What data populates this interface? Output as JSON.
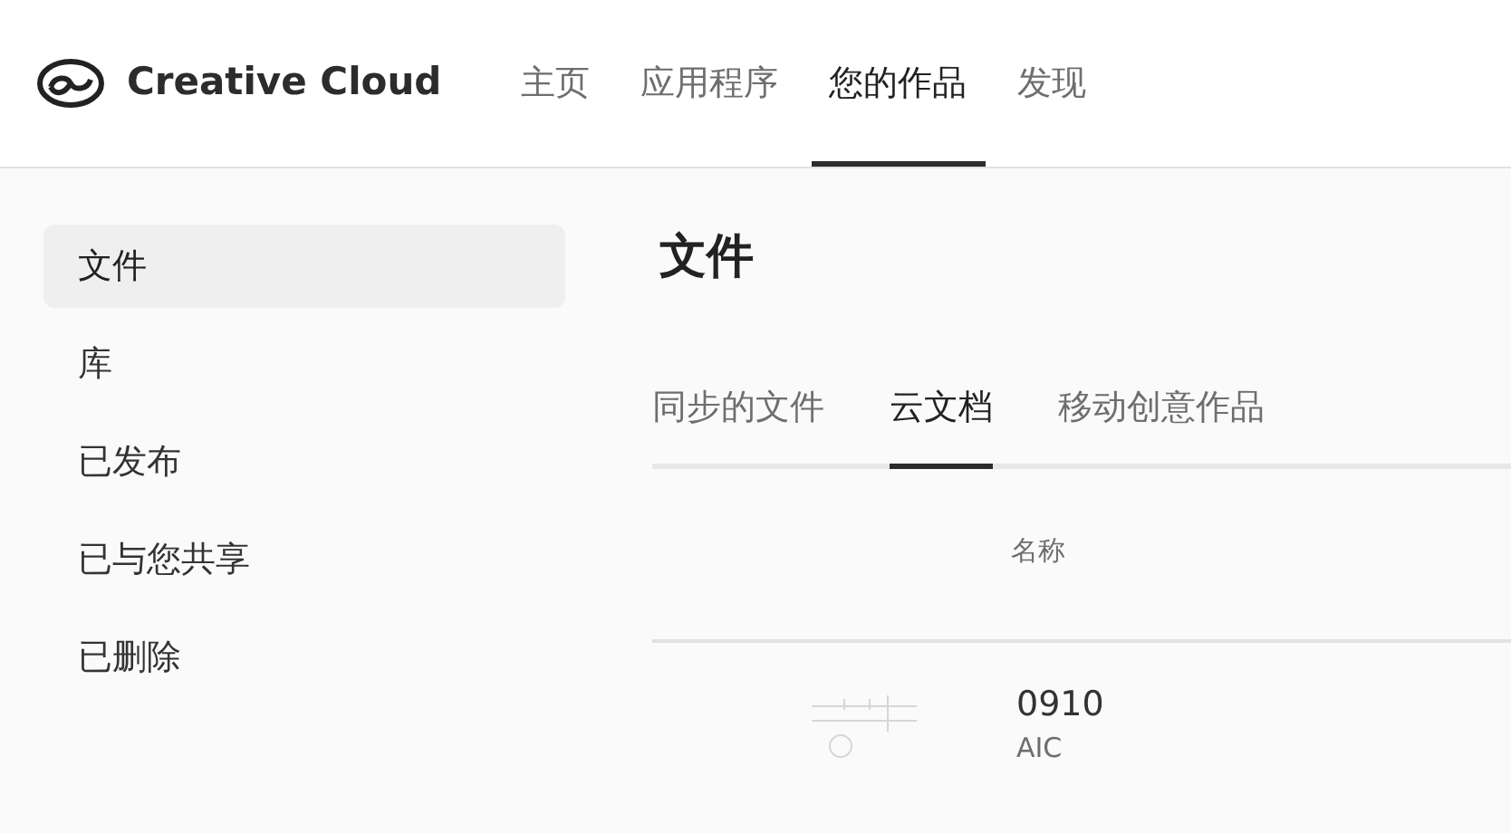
{
  "app": {
    "name": "Creative Cloud"
  },
  "nav": [
    {
      "label": "主页",
      "selected": false
    },
    {
      "label": "应用程序",
      "selected": false
    },
    {
      "label": "您的作品",
      "selected": true
    },
    {
      "label": "发现",
      "selected": false
    }
  ],
  "sidebar": {
    "items": [
      {
        "label": "文件",
        "selected": true
      },
      {
        "label": "库",
        "selected": false
      },
      {
        "label": "已发布",
        "selected": false
      },
      {
        "label": "已与您共享",
        "selected": false
      },
      {
        "label": "已删除",
        "selected": false
      }
    ]
  },
  "main": {
    "title": "文件",
    "tabs": [
      {
        "label": "同步的文件",
        "selected": false
      },
      {
        "label": "云文档",
        "selected": true
      },
      {
        "label": "移动创意作品",
        "selected": false
      }
    ],
    "table": {
      "columns": [
        "名称"
      ],
      "rows": [
        {
          "name": "0910",
          "type": "AIC"
        }
      ]
    }
  }
}
